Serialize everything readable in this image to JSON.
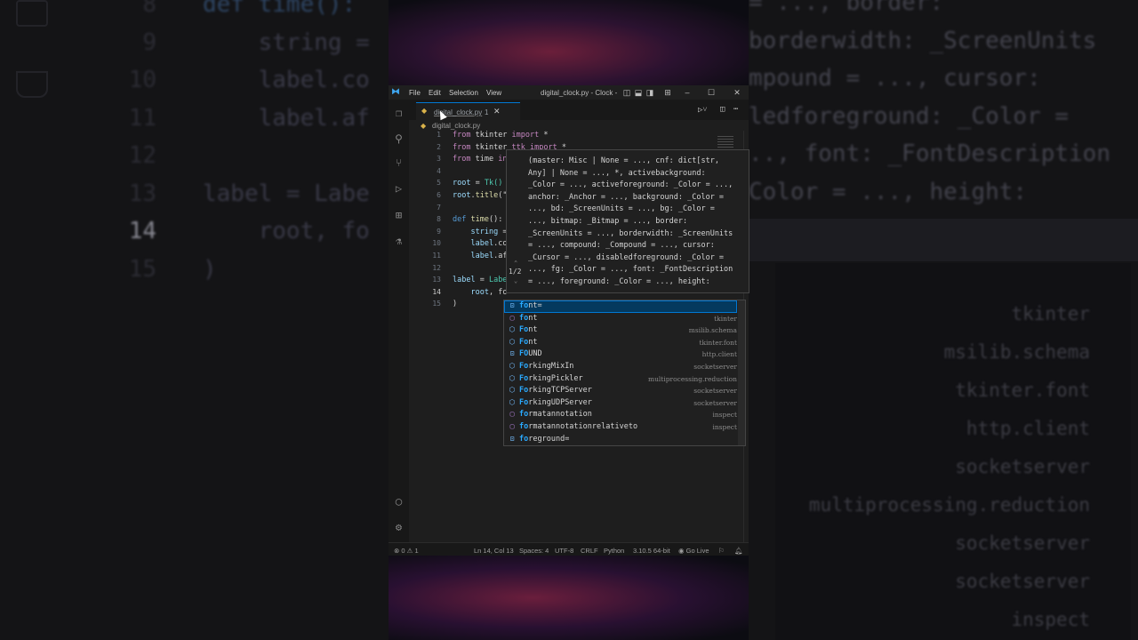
{
  "window": {
    "title": "digital_clock.py - Clock -",
    "menu": [
      "File",
      "Edit",
      "Selection",
      "View"
    ]
  },
  "tab": {
    "name": "digital_clock.py",
    "badge": "1"
  },
  "breadcrumb": "digital_clock.py",
  "editor": {
    "line_numbers": [
      "1",
      "2",
      "3",
      "4",
      "5",
      "6",
      "7",
      "8",
      "9",
      "10",
      "11",
      "12",
      "13",
      "14",
      "15"
    ],
    "active_line": "14",
    "lines": [
      [
        "from",
        " tkinter ",
        "import",
        " *"
      ],
      [
        "from",
        " tkinter ",
        "ttk import",
        " *"
      ],
      [
        "from",
        " time ",
        "in"
      ],
      [],
      [
        "root",
        " = ",
        "Tk()"
      ],
      [
        "root",
        ".",
        "title",
        "(\""
      ],
      [],
      [
        "def",
        " ",
        "time",
        "():"
      ],
      [
        "    ",
        "string",
        " ="
      ],
      [
        "    ",
        "label",
        ".co"
      ],
      [
        "    ",
        "label",
        ".af"
      ],
      [],
      [
        "label",
        " = ",
        "Labe"
      ],
      [
        "    ",
        "root",
        ", ",
        "fo"
      ],
      [
        ")"
      ]
    ]
  },
  "signature_help": {
    "text": "(master: Misc | None = ..., cnf: dict[str,\nAny] | None = ..., *, activebackground:\n_Color = ..., activeforeground: _Color = ...,\nanchor: _Anchor = ..., background: _Color =\n..., bd: _ScreenUnits = ..., bg: _Color =\n..., bitmap: _Bitmap = ..., border:\n_ScreenUnits = ..., borderwidth: _ScreenUnits\n= ..., compound: _Compound = ..., cursor:\n_Cursor = ..., disabledforeground: _Color =\n..., fg: _Color = ..., font: _FontDescription\n= ..., foreground: _Color = ..., height:",
    "pager": "1/2"
  },
  "suggestions": [
    {
      "icon": "var",
      "match": "fo",
      "rest": "nt=",
      "detail": ""
    },
    {
      "icon": "fn",
      "match": "fo",
      "rest": "nt",
      "detail": "tkinter"
    },
    {
      "icon": "cls",
      "match": "Fo",
      "rest": "nt",
      "detail": "msilib.schema"
    },
    {
      "icon": "cls",
      "match": "Fo",
      "rest": "nt",
      "detail": "tkinter.font"
    },
    {
      "icon": "var",
      "match": "FO",
      "rest": "UND",
      "detail": "http.client"
    },
    {
      "icon": "cls",
      "match": "Fo",
      "rest": "rkingMixIn",
      "detail": "socketserver"
    },
    {
      "icon": "cls",
      "match": "Fo",
      "rest": "rkingPickler",
      "detail": "multiprocessing.reduction"
    },
    {
      "icon": "cls",
      "match": "Fo",
      "rest": "rkingTCPServer",
      "detail": "socketserver"
    },
    {
      "icon": "cls",
      "match": "Fo",
      "rest": "rkingUDPServer",
      "detail": "socketserver"
    },
    {
      "icon": "fn",
      "match": "fo",
      "rest": "rmatannotation",
      "detail": "inspect"
    },
    {
      "icon": "fn",
      "match": "fo",
      "rest": "rmatannotationrelativeto",
      "detail": "inspect"
    },
    {
      "icon": "var",
      "match": "fo",
      "rest": "reground=",
      "detail": ""
    }
  ],
  "statusbar": {
    "errors": "0",
    "warnings": "1",
    "position": "Ln 14, Col 13",
    "spaces": "Spaces: 4",
    "encoding": "UTF-8",
    "eol": "CRLF",
    "language": "Python",
    "interpreter": "3.10.5 64-bit",
    "golive": "Go Live"
  },
  "background": {
    "left_lines": [
      {
        "num": "8",
        "code": "def time():"
      },
      {
        "num": "9",
        "code": "    string ="
      },
      {
        "num": "10",
        "code": "    label.co"
      },
      {
        "num": "11",
        "code": "    label.af"
      },
      {
        "num": "12",
        "code": ""
      },
      {
        "num": "13",
        "code": "label = Labe"
      },
      {
        "num": "14",
        "code": "    root, fo"
      },
      {
        "num": "15",
        "code": ")"
      }
    ],
    "right_lines": [
      "= ..., border:",
      "borderwidth: _ScreenUnits",
      "mpound = ..., cursor:",
      "ledforeground: _Color =",
      ".., font: _FontDescription",
      "Color = ..., height:"
    ],
    "right_details": [
      "tkinter",
      "msilib.schema",
      "tkinter.font",
      "http.client",
      "socketserver",
      "multiprocessing.reduction",
      "socketserver",
      "socketserver",
      "inspect"
    ]
  }
}
